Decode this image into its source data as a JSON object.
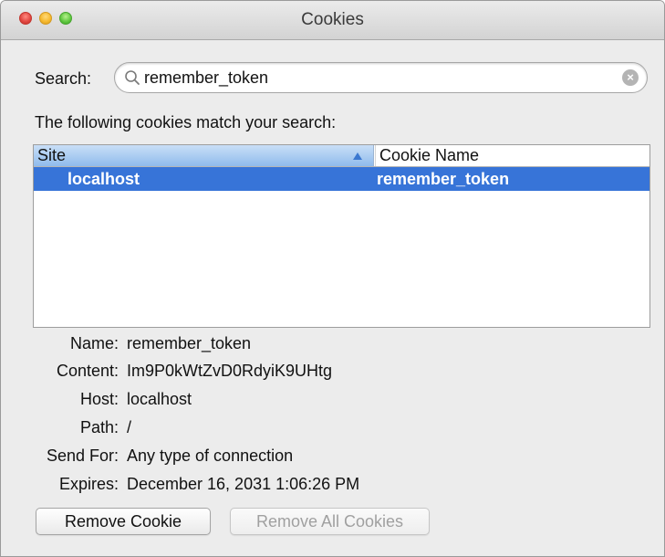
{
  "window": {
    "title": "Cookies"
  },
  "search": {
    "label": "Search:",
    "value": "remember_token",
    "placeholder": ""
  },
  "results": {
    "heading": "The following cookies match your search:",
    "columns": {
      "site": "Site",
      "cookie_name": "Cookie Name"
    },
    "sort": "ascending",
    "rows": [
      {
        "site": "localhost",
        "cookie_name": "remember_token",
        "selected": true
      }
    ]
  },
  "details": [
    {
      "label": "Name:",
      "value": "remember_token"
    },
    {
      "label": "Content:",
      "value": "Im9P0kWtZvD0RdyiK9UHtg"
    },
    {
      "label": "Host:",
      "value": "localhost"
    },
    {
      "label": "Path:",
      "value": "/"
    },
    {
      "label": "Send For:",
      "value": "Any type of connection"
    },
    {
      "label": "Expires:",
      "value": "December 16, 2031 1:06:26 PM"
    }
  ],
  "buttons": {
    "remove_cookie": "Remove Cookie",
    "remove_all_cookies": "Remove All Cookies"
  },
  "colors": {
    "selection": "#3774d8",
    "header_selected": "#8fbbec",
    "window_bg": "#ececec"
  }
}
